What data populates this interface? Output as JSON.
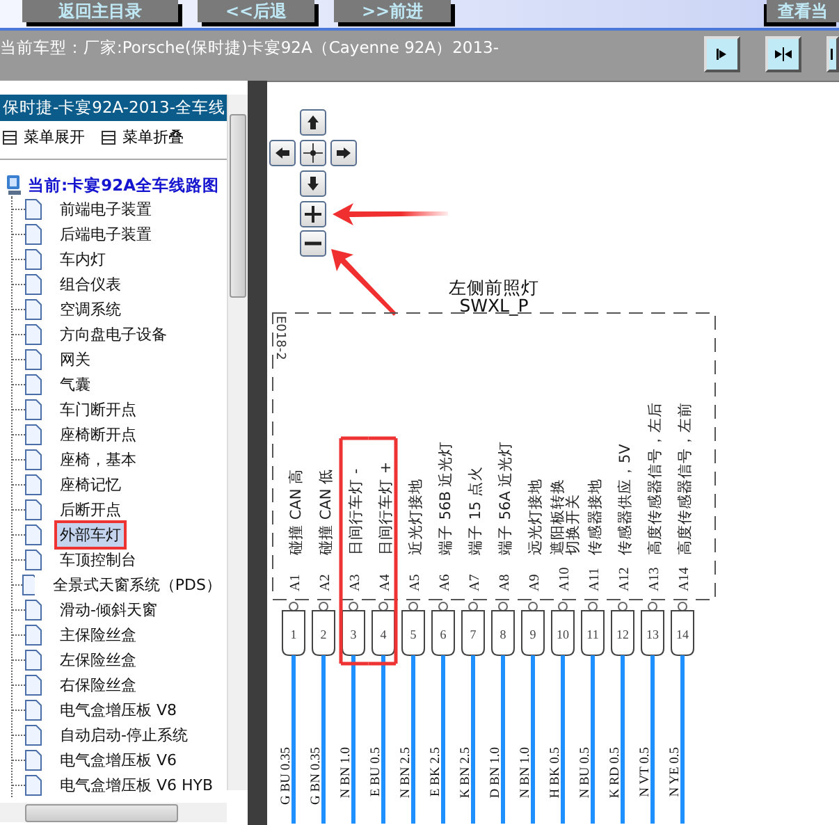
{
  "toolbar": {
    "buttons": [
      "返回主目录",
      "<<后退",
      ">>前进"
    ],
    "right_button": "查看当"
  },
  "vehicle_bar": {
    "text": "当前车型：厂家:Porsche(保时捷)卡宴92A（Cayenne 92A）2013-"
  },
  "sidebar": {
    "title": "保时捷-卡宴92A-2013-全车线",
    "actions": [
      "菜单展开",
      "菜单折叠"
    ],
    "root": "当前:卡宴92A全车线路图",
    "items": [
      {
        "label": "前端电子装置",
        "selected": false,
        "marked": false
      },
      {
        "label": "后端电子装置",
        "selected": false,
        "marked": false
      },
      {
        "label": "车内灯",
        "selected": false,
        "marked": false
      },
      {
        "label": "组合仪表",
        "selected": false,
        "marked": false
      },
      {
        "label": "空调系统",
        "selected": false,
        "marked": false
      },
      {
        "label": "方向盘电子设备",
        "selected": false,
        "marked": false
      },
      {
        "label": "网关",
        "selected": false,
        "marked": false
      },
      {
        "label": "气囊",
        "selected": false,
        "marked": false
      },
      {
        "label": "车门断开点",
        "selected": false,
        "marked": false
      },
      {
        "label": "座椅断开点",
        "selected": false,
        "marked": false
      },
      {
        "label": "座椅，基本",
        "selected": false,
        "marked": false
      },
      {
        "label": "座椅记忆",
        "selected": false,
        "marked": false
      },
      {
        "label": "后断开点",
        "selected": false,
        "marked": false
      },
      {
        "label": "外部车灯",
        "selected": true,
        "marked": true
      },
      {
        "label": "车顶控制台",
        "selected": false,
        "marked": false
      },
      {
        "label": "全景式天窗系统（PDS）",
        "selected": false,
        "marked": false
      },
      {
        "label": "滑动-倾斜天窗",
        "selected": false,
        "marked": false
      },
      {
        "label": "主保险丝盒",
        "selected": false,
        "marked": false
      },
      {
        "label": "左保险丝盒",
        "selected": false,
        "marked": false
      },
      {
        "label": "右保险丝盒",
        "selected": false,
        "marked": false
      },
      {
        "label": "电气盒增压板 V8",
        "selected": false,
        "marked": false
      },
      {
        "label": "自动启动-停止系统",
        "selected": false,
        "marked": false
      },
      {
        "label": "电气盒增压板 V6",
        "selected": false,
        "marked": false
      },
      {
        "label": "电气盒增压板 V6 HYB",
        "selected": false,
        "marked": false
      }
    ]
  },
  "diagram": {
    "title": "左侧前照灯",
    "code": "SWXL_P",
    "side_label": "E018-2",
    "pins": [
      {
        "id": "A1",
        "function_lines": [
          "碰撞 CAN 高"
        ],
        "number": "1",
        "wire": "G BU 0.35",
        "marked": false
      },
      {
        "id": "A2",
        "function_lines": [
          "碰撞 CAN 低"
        ],
        "number": "2",
        "wire": "G BN 0.35",
        "marked": false
      },
      {
        "id": "A3",
        "function_lines": [
          "日间行车灯 -"
        ],
        "number": "3",
        "wire": "N BN 1.0",
        "marked": true
      },
      {
        "id": "A4",
        "function_lines": [
          "日间行车灯 +"
        ],
        "number": "4",
        "wire": "E BU 0.5",
        "marked": true
      },
      {
        "id": "A5",
        "function_lines": [
          "近光灯接地"
        ],
        "number": "5",
        "wire": "N BN 2.5",
        "marked": false
      },
      {
        "id": "A6",
        "function_lines": [
          "端子 56B 近光灯"
        ],
        "number": "6",
        "wire": "E BK 2.5",
        "marked": false
      },
      {
        "id": "A7",
        "function_lines": [
          "端子 15 点火"
        ],
        "number": "7",
        "wire": "K BN 2.5",
        "marked": false
      },
      {
        "id": "A8",
        "function_lines": [
          "端子 56A 近光灯"
        ],
        "number": "8",
        "wire": "D BN 1.0",
        "marked": false
      },
      {
        "id": "A9",
        "function_lines": [
          "远光灯接地"
        ],
        "number": "9",
        "wire": "N BN 1.0",
        "marked": false
      },
      {
        "id": "A10",
        "function_lines": [
          "遮阳板转换",
          "切换开关"
        ],
        "number": "10",
        "wire": "H BK 0.5",
        "marked": false
      },
      {
        "id": "A11",
        "function_lines": [
          "传感器接地"
        ],
        "number": "11",
        "wire": "N BU 0.5",
        "marked": false
      },
      {
        "id": "A12",
        "function_lines": [
          "传感器供应，5V"
        ],
        "number": "12",
        "wire": "K RD 0.5",
        "marked": false
      },
      {
        "id": "A13",
        "function_lines": [
          "高度传感器信号，左后"
        ],
        "number": "13",
        "wire": "N VT 0.5",
        "marked": false
      },
      {
        "id": "A14",
        "function_lines": [
          "高度传感器信号，左前"
        ],
        "number": "14",
        "wire": "N YE 0.5",
        "marked": false
      }
    ]
  }
}
